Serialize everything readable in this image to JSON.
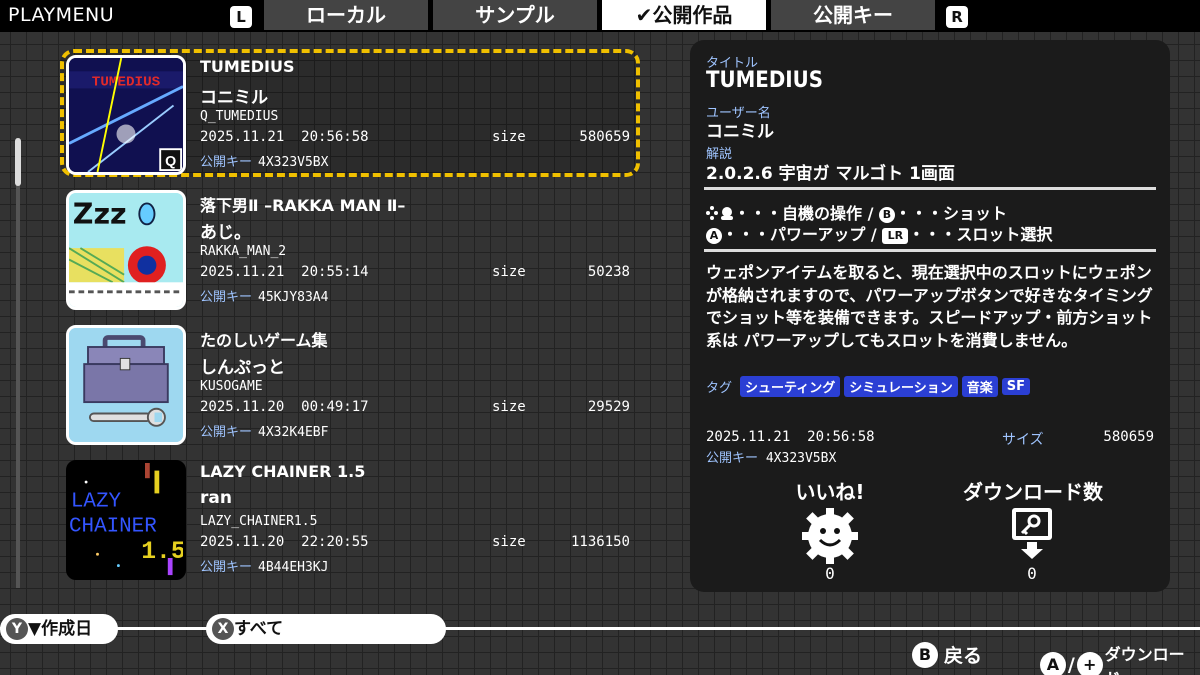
{
  "app_title": "PLAYMENU",
  "tabs": {
    "left_shoulder": "L",
    "right_shoulder": "R",
    "items": [
      {
        "label": "ローカル"
      },
      {
        "label": "サンプル"
      },
      {
        "label": "✔公開作品"
      },
      {
        "label": "公開キー"
      }
    ],
    "active_index": 2
  },
  "items": [
    {
      "title": "TUMEDIUS",
      "author": "コニミル",
      "id": "Q_TUMEDIUS",
      "date": "2025.11.21",
      "time": "20:56:58",
      "size_label": "size",
      "size": "580659",
      "key_label": "公開キー",
      "key": "4X323V5BX",
      "thumb_text": "TUMEDIUS",
      "thumb_badge": "Q",
      "selected": true
    },
    {
      "title": "落下男Ⅱ –RAKKA MAN Ⅱ–",
      "author": "あじ。",
      "id": "RAKKA_MAN_2",
      "date": "2025.11.21",
      "time": "20:55:14",
      "size_label": "size",
      "size": "50238",
      "key_label": "公開キー",
      "key": "45KJY83A4",
      "thumb_text": "Zzz"
    },
    {
      "title": "たのしいゲーム集",
      "author": "しんぷっと",
      "id": "KUSOGAME",
      "date": "2025.11.20",
      "time": "00:49:17",
      "size_label": "size",
      "size": "29529",
      "key_label": "公開キー",
      "key": "4X32K4EBF"
    },
    {
      "title": "LAZY CHAINER 1.5",
      "author": "ran",
      "id": "LAZY_CHAINER1.5",
      "date": "2025.11.20",
      "time": "22:20:55",
      "size_label": "size",
      "size": "1136150",
      "key_label": "公開キー",
      "key": "4B44EH3KJ",
      "thumb_text_1": "LAZY",
      "thumb_text_2": "CHAINER",
      "thumb_text_3": "1.5"
    }
  ],
  "detail": {
    "title_label": "タイトル",
    "title": "TUMEDIUS",
    "user_label": "ユーザー名",
    "user": "コニミル",
    "desc_label": "解説",
    "desc_head": "2.0.2.6 宇宙ガ マルゴト 1画面",
    "controls_1_a": "・・・自機の操作 / ",
    "controls_1_b_glyph": "B",
    "controls_1_b": "・・・ショット",
    "controls_2_a_glyph": "A",
    "controls_2_a": "・・・パワーアップ / ",
    "controls_2_b_glyph": "LR",
    "controls_2_b": "・・・スロット選択",
    "description": "ウェポンアイテムを取ると、現在選択中のスロットにウェポンが格納されますので、パワーアップボタンで好きなタイミングでショット等を装備できます。スピードアップ・前方ショット系は パワーアップしてもスロットを消費しません。",
    "tags_label": "タグ",
    "tags": [
      "シューティング",
      "シミュレーション",
      "音楽",
      "SF"
    ],
    "date": "2025.11.21",
    "time": "20:56:58",
    "size_label": "サイズ",
    "size": "580659",
    "key_label": "公開キー",
    "key": "4X323V5BX",
    "like_label": "いいね!",
    "like_count": "0",
    "download_label": "ダウンロード数",
    "download_count": "0"
  },
  "bottom": {
    "sort_glyph": "Y",
    "sort_label": "▼作成日",
    "filter_glyph": "X",
    "filter_label": "すべて",
    "back_glyph": "B",
    "back_label": "戻る",
    "download_glyph": "A",
    "download_sep": "/",
    "download_plus": "+",
    "download_label": "ダウンロード"
  },
  "colors": {
    "accent_selection": "#f0c000",
    "tag_bg": "#2b3fd4",
    "label_blue": "#9fc4ff"
  }
}
